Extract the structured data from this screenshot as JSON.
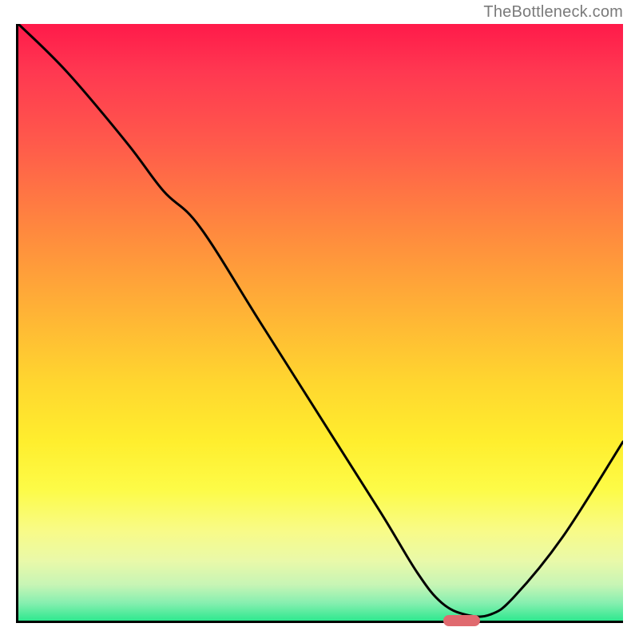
{
  "watermark": "TheBottleneck.com",
  "chart_data": {
    "type": "line",
    "title": "",
    "xlabel": "",
    "ylabel": "",
    "xlim": [
      0,
      100
    ],
    "ylim": [
      0,
      100
    ],
    "grid": false,
    "legend": false,
    "series": [
      {
        "name": "bottleneck-curve",
        "x": [
          0,
          8,
          18,
          24,
          30,
          40,
          50,
          60,
          66,
          70,
          74,
          78,
          82,
          90,
          100
        ],
        "y": [
          100,
          92,
          80,
          72,
          66,
          50,
          34,
          18,
          8,
          3,
          1,
          1,
          4,
          14,
          30
        ]
      }
    ],
    "marker": {
      "x_start": 70,
      "x_end": 76,
      "y": 0
    },
    "gradient_stops": [
      {
        "pos": 0,
        "color": "#ff1a4a"
      },
      {
        "pos": 50,
        "color": "#ffd62f"
      },
      {
        "pos": 85,
        "color": "#f8fb88"
      },
      {
        "pos": 100,
        "color": "#2fe88f"
      }
    ]
  }
}
